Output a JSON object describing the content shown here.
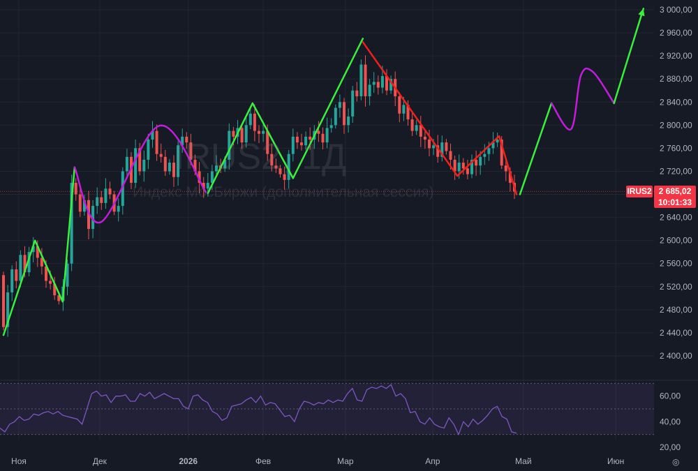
{
  "chart_data": {
    "type": "candlestick",
    "symbol": "IRUS2",
    "interval": "1Д",
    "watermark_title": "IRUS2, 1Д",
    "watermark_subtitle": "Индекс МосБиржи (дополнительная сессия)",
    "last_price": "2 685,02",
    "countdown": "10:01:33",
    "first_open": 2540,
    "closes": [
      2450,
      2510,
      2550,
      2530,
      2575,
      2545,
      2580,
      2590,
      2570,
      2555,
      2530,
      2525,
      2505,
      2495,
      2520,
      2560,
      2700,
      2680,
      2650,
      2670,
      2620,
      2660,
      2675,
      2665,
      2690,
      2680,
      2650,
      2660,
      2720,
      2745,
      2700,
      2760,
      2720,
      2740,
      2775,
      2790,
      2750,
      2745,
      2720,
      2735,
      2710,
      2765,
      2780,
      2770,
      2740,
      2720,
      2700,
      2690,
      2700,
      2720,
      2730,
      2725,
      2740,
      2790,
      2780,
      2795,
      2770,
      2800,
      2820,
      2790,
      2785,
      2790,
      2750,
      2730,
      2725,
      2715,
      2705,
      2750,
      2780,
      2770,
      2765,
      2780,
      2775,
      2790,
      2785,
      2770,
      2795,
      2800,
      2830,
      2840,
      2800,
      2815,
      2860,
      2850,
      2905,
      2850,
      2870,
      2875,
      2865,
      2885,
      2860,
      2880,
      2850,
      2820,
      2835,
      2810,
      2790,
      2800,
      2780,
      2775,
      2760,
      2765,
      2745,
      2770,
      2755,
      2740,
      2720,
      2735,
      2725,
      2715,
      2740,
      2730,
      2745,
      2750,
      2760,
      2770,
      2775,
      2730,
      2720,
      2700,
      2685
    ],
    "price_axis": {
      "min": 2400,
      "max": 3000,
      "step": 40,
      "labels": [
        "3 000,00",
        "2 960,00",
        "2 920,00",
        "2 880,00",
        "2 840,00",
        "2 800,00",
        "2 760,00",
        "2 720,00",
        "2 680,00",
        "2 640,00",
        "2 600,00",
        "2 560,00",
        "2 520,00",
        "2 480,00",
        "2 440,00",
        "2 400,00"
      ]
    },
    "time_axis": [
      {
        "label": "Ноя",
        "bar": 3.6
      },
      {
        "label": "Дек",
        "bar": 22.6
      },
      {
        "label": "2026",
        "bar": 43.4
      },
      {
        "label": "Фев",
        "bar": 61
      },
      {
        "label": "Мар",
        "bar": 80.3
      },
      {
        "label": "Апр",
        "bar": 100.8
      },
      {
        "label": "Май",
        "bar": 122.1
      },
      {
        "label": "Июн",
        "bar": 143.8
      }
    ],
    "drawings": [
      {
        "name": "zigzag-green-1",
        "color": "#39f03c",
        "smooth": false,
        "points": [
          [
            0,
            2436
          ],
          [
            7.4,
            2600
          ],
          [
            13.9,
            2494
          ],
          [
            16.7,
            2727
          ]
        ]
      },
      {
        "name": "curve-purple-1",
        "color": "#c21ddb",
        "smooth": true,
        "points": [
          [
            16.7,
            2727
          ],
          [
            22.9,
            2632
          ],
          [
            36.6,
            2799
          ],
          [
            47.5,
            2684
          ]
        ]
      },
      {
        "name": "zigzag-green-2",
        "color": "#39f03c",
        "smooth": false,
        "points": [
          [
            48,
            2682
          ],
          [
            58.5,
            2838
          ],
          [
            68,
            2708
          ],
          [
            84.4,
            2950
          ]
        ]
      },
      {
        "name": "zigzag-red",
        "color": "#f0201c",
        "smooth": false,
        "points": [
          [
            84.4,
            2944
          ],
          [
            106.6,
            2712
          ],
          [
            116.4,
            2781
          ],
          [
            120.5,
            2680
          ]
        ]
      },
      {
        "name": "forecast-green",
        "color": "#39f03c",
        "smooth": false,
        "points": [
          [
            121.3,
            2680
          ],
          [
            128.7,
            2838
          ]
        ]
      },
      {
        "name": "forecast-purple",
        "color": "#c21ddb",
        "smooth": true,
        "points": [
          [
            128.7,
            2838
          ],
          [
            133.3,
            2793
          ],
          [
            135.6,
            2886
          ],
          [
            138.5,
            2892
          ],
          [
            143.4,
            2838
          ]
        ]
      },
      {
        "name": "forecast-green-arrow",
        "color": "#39f03c",
        "smooth": false,
        "arrow": true,
        "points": [
          [
            143.4,
            2838
          ],
          [
            150.3,
            3002
          ]
        ]
      }
    ],
    "rsi": {
      "levels": [
        70,
        50,
        30
      ],
      "axis_labels": [
        {
          "v": 60,
          "label": "60,00"
        },
        {
          "v": 40,
          "label": "40,00"
        },
        {
          "v": 20,
          "label": "20,00"
        }
      ],
      "values": [
        35,
        32,
        38,
        40,
        44,
        41,
        42,
        46,
        45,
        47,
        48,
        46,
        48,
        45,
        44,
        43,
        42,
        38,
        50,
        62,
        64,
        60,
        61,
        55,
        60,
        60,
        61,
        56,
        56,
        62,
        60,
        63,
        58,
        60,
        62,
        60,
        58,
        58,
        52,
        50,
        60,
        61,
        57,
        55,
        48,
        46,
        41,
        43,
        52,
        53,
        54,
        57,
        59,
        55,
        60,
        53,
        55,
        54,
        49,
        44,
        45,
        40,
        50,
        56,
        55,
        53,
        55,
        54,
        57,
        55,
        57,
        56,
        62,
        66,
        57,
        56,
        65,
        67,
        66,
        68,
        66,
        69,
        60,
        62,
        58,
        47,
        48,
        40,
        38,
        43,
        38,
        36,
        35,
        43,
        38,
        30,
        40,
        36,
        42,
        38,
        41,
        45,
        50,
        52,
        44,
        42,
        32,
        31
      ],
      "color": "#7e57c2"
    },
    "colors": {
      "up": "#26a69a",
      "down": "#ef5350",
      "background": "#161a25",
      "grid": "#232632",
      "axis_text": "#b2b5be"
    }
  }
}
